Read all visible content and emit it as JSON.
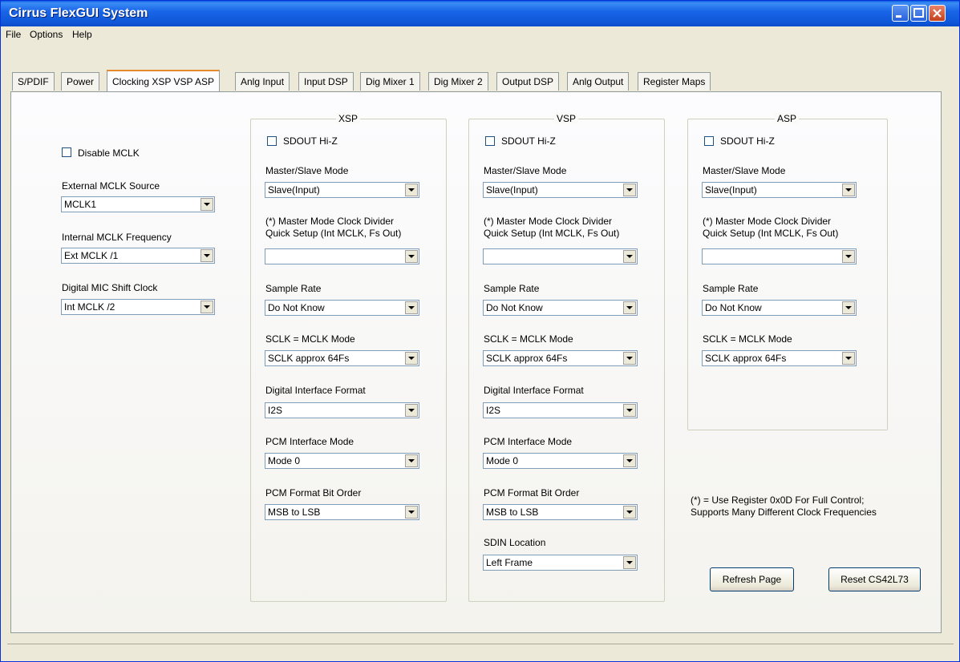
{
  "window": {
    "title": "Cirrus FlexGUI System"
  },
  "menu": {
    "file": "File",
    "options": "Options",
    "help": "Help"
  },
  "tabs": [
    "S/PDIF",
    "Power",
    "Clocking XSP VSP ASP",
    "Anlg Input",
    "Input DSP",
    "Dig Mixer 1",
    "Dig Mixer 2",
    "Output DSP",
    "Anlg Output",
    "Register Maps"
  ],
  "left": {
    "disable_mclk": "Disable MCLK",
    "ext_mclk_label": "External MCLK Source",
    "ext_mclk_value": "MCLK1",
    "int_mclk_label": "Internal MCLK Frequency",
    "int_mclk_value": "Ext MCLK /1",
    "dmic_label": "Digital MIC Shift Clock",
    "dmic_value": "Int MCLK /2"
  },
  "labels": {
    "sdout_hiz": "SDOUT Hi-Z",
    "ms_mode": "Master/Slave Mode",
    "clkdiv_line1": "(*) Master Mode Clock Divider",
    "clkdiv_line2": "Quick Setup (Int MCLK, Fs Out)",
    "sample_rate": "Sample Rate",
    "sclk_mode": "SCLK = MCLK Mode",
    "dif": "Digital Interface Format",
    "pcm_mode": "PCM Interface Mode",
    "pcm_order": "PCM Format Bit Order",
    "sdin_loc": "SDIN Location"
  },
  "xsp": {
    "title": "XSP",
    "ms": "Slave(Input)",
    "clkdiv": "",
    "sr": "Do Not Know",
    "sclk": "SCLK approx 64Fs",
    "dif": "I2S",
    "pcm_mode": "Mode 0",
    "pcm_order": "MSB to LSB"
  },
  "vsp": {
    "title": "VSP",
    "ms": "Slave(Input)",
    "clkdiv": "",
    "sr": "Do Not Know",
    "sclk": "SCLK approx 64Fs",
    "dif": "I2S",
    "pcm_mode": "Mode 0",
    "pcm_order": "MSB to LSB",
    "sdin": "Left Frame"
  },
  "asp": {
    "title": "ASP",
    "ms": "Slave(Input)",
    "clkdiv": "",
    "sr": "Do Not Know",
    "sclk": "SCLK approx 64Fs"
  },
  "note": {
    "line1": "(*) = Use Register 0x0D For Full Control;",
    "line2": "Supports Many Different Clock Frequencies"
  },
  "buttons": {
    "refresh": "Refresh Page",
    "reset": "Reset CS42L73"
  }
}
